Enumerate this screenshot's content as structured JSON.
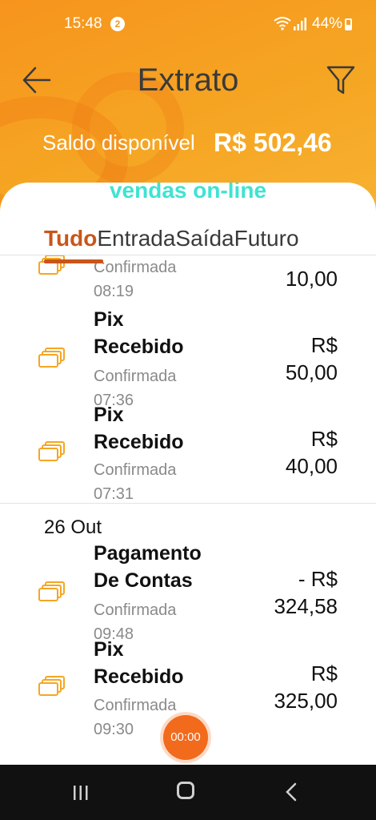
{
  "status_bar": {
    "time": "15:48",
    "notification_count": "2",
    "battery": "44%"
  },
  "header": {
    "title": "Extrato",
    "balance_label": "Saldo disponível",
    "balance_value": "R$ 502,46"
  },
  "watermark": "vendas on-line",
  "tabs": [
    {
      "label": "Tudo",
      "active": true
    },
    {
      "label": "Entrada",
      "active": false
    },
    {
      "label": "Saída",
      "active": false
    },
    {
      "label": "Futuro",
      "active": false
    }
  ],
  "transactions": [
    {
      "title_lines": [],
      "status": "Confirmada",
      "time": "08:19",
      "amount_lines": [
        "10,00"
      ]
    },
    {
      "title_lines": [
        "Pix",
        "Recebido"
      ],
      "status": "Confirmada",
      "time": "07:36",
      "amount_lines": [
        "R$",
        "50,00"
      ]
    },
    {
      "title_lines": [
        "Pix",
        "Recebido"
      ],
      "status": "Confirmada",
      "time": "07:31",
      "amount_lines": [
        "R$",
        "40,00"
      ]
    }
  ],
  "group_date": "26 Out",
  "transactions_group2": [
    {
      "title_lines": [
        "Pagamento",
        "De Contas"
      ],
      "status": "Confirmada",
      "time": "09:48",
      "amount_lines": [
        "- R$",
        "324,58"
      ]
    },
    {
      "title_lines": [
        "Pix",
        "Recebido"
      ],
      "status": "Confirmada",
      "time": "09:30",
      "amount_lines": [
        "R$",
        "325,00"
      ]
    }
  ],
  "timer": "00:00",
  "colors": {
    "header_orange": "#f7941d",
    "active_tab": "#c8561a",
    "watermark": "#3fe3d2",
    "icon_orange": "#f5a623"
  }
}
